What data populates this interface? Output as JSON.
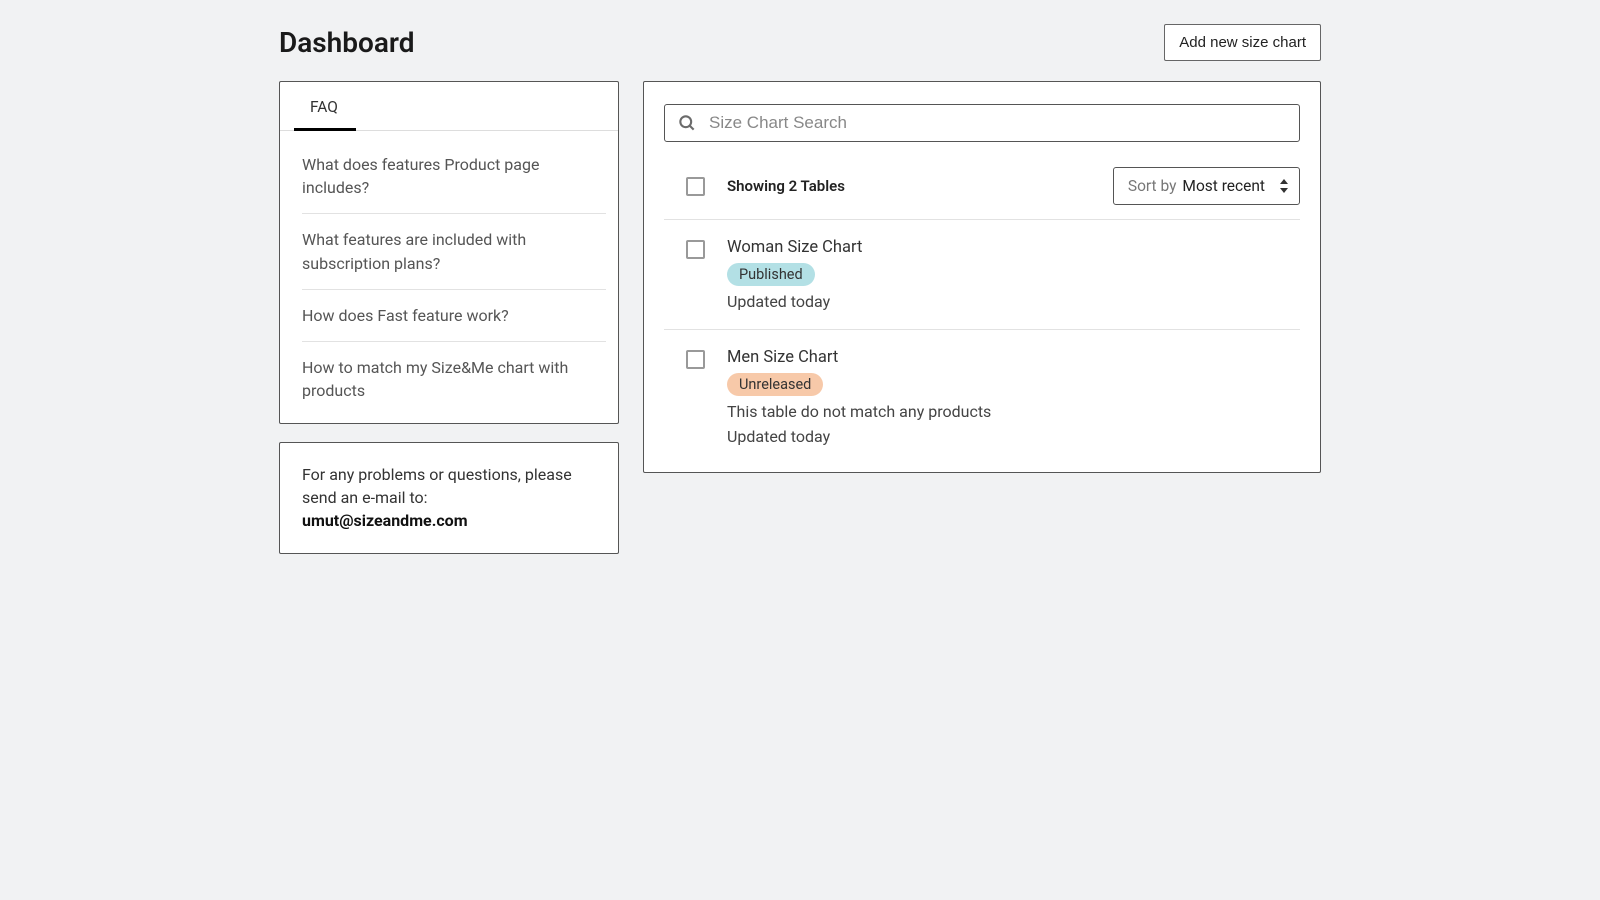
{
  "header": {
    "title": "Dashboard",
    "add_button": "Add new size chart"
  },
  "faq": {
    "tab_label": "FAQ",
    "items": [
      "What does features Product page includes?",
      "What features are included with subscription plans?",
      "How does Fast feature work?",
      "How to match my Size&Me chart with products"
    ]
  },
  "contact": {
    "text_prefix": "For any problems or questions, please send an e-mail to: ",
    "email": "umut@sizeandme.com"
  },
  "search": {
    "placeholder": "Size Chart Search"
  },
  "list": {
    "showing": "Showing 2 Tables",
    "sort_label": "Sort by ",
    "sort_value": "Most recent",
    "rows": [
      {
        "title": "Woman Size Chart",
        "status": "Published",
        "status_class": "published",
        "note": "",
        "updated": "Updated today"
      },
      {
        "title": "Men Size Chart",
        "status": "Unreleased",
        "status_class": "unreleased",
        "note": "This table do not match any products",
        "updated": "Updated today"
      }
    ]
  }
}
